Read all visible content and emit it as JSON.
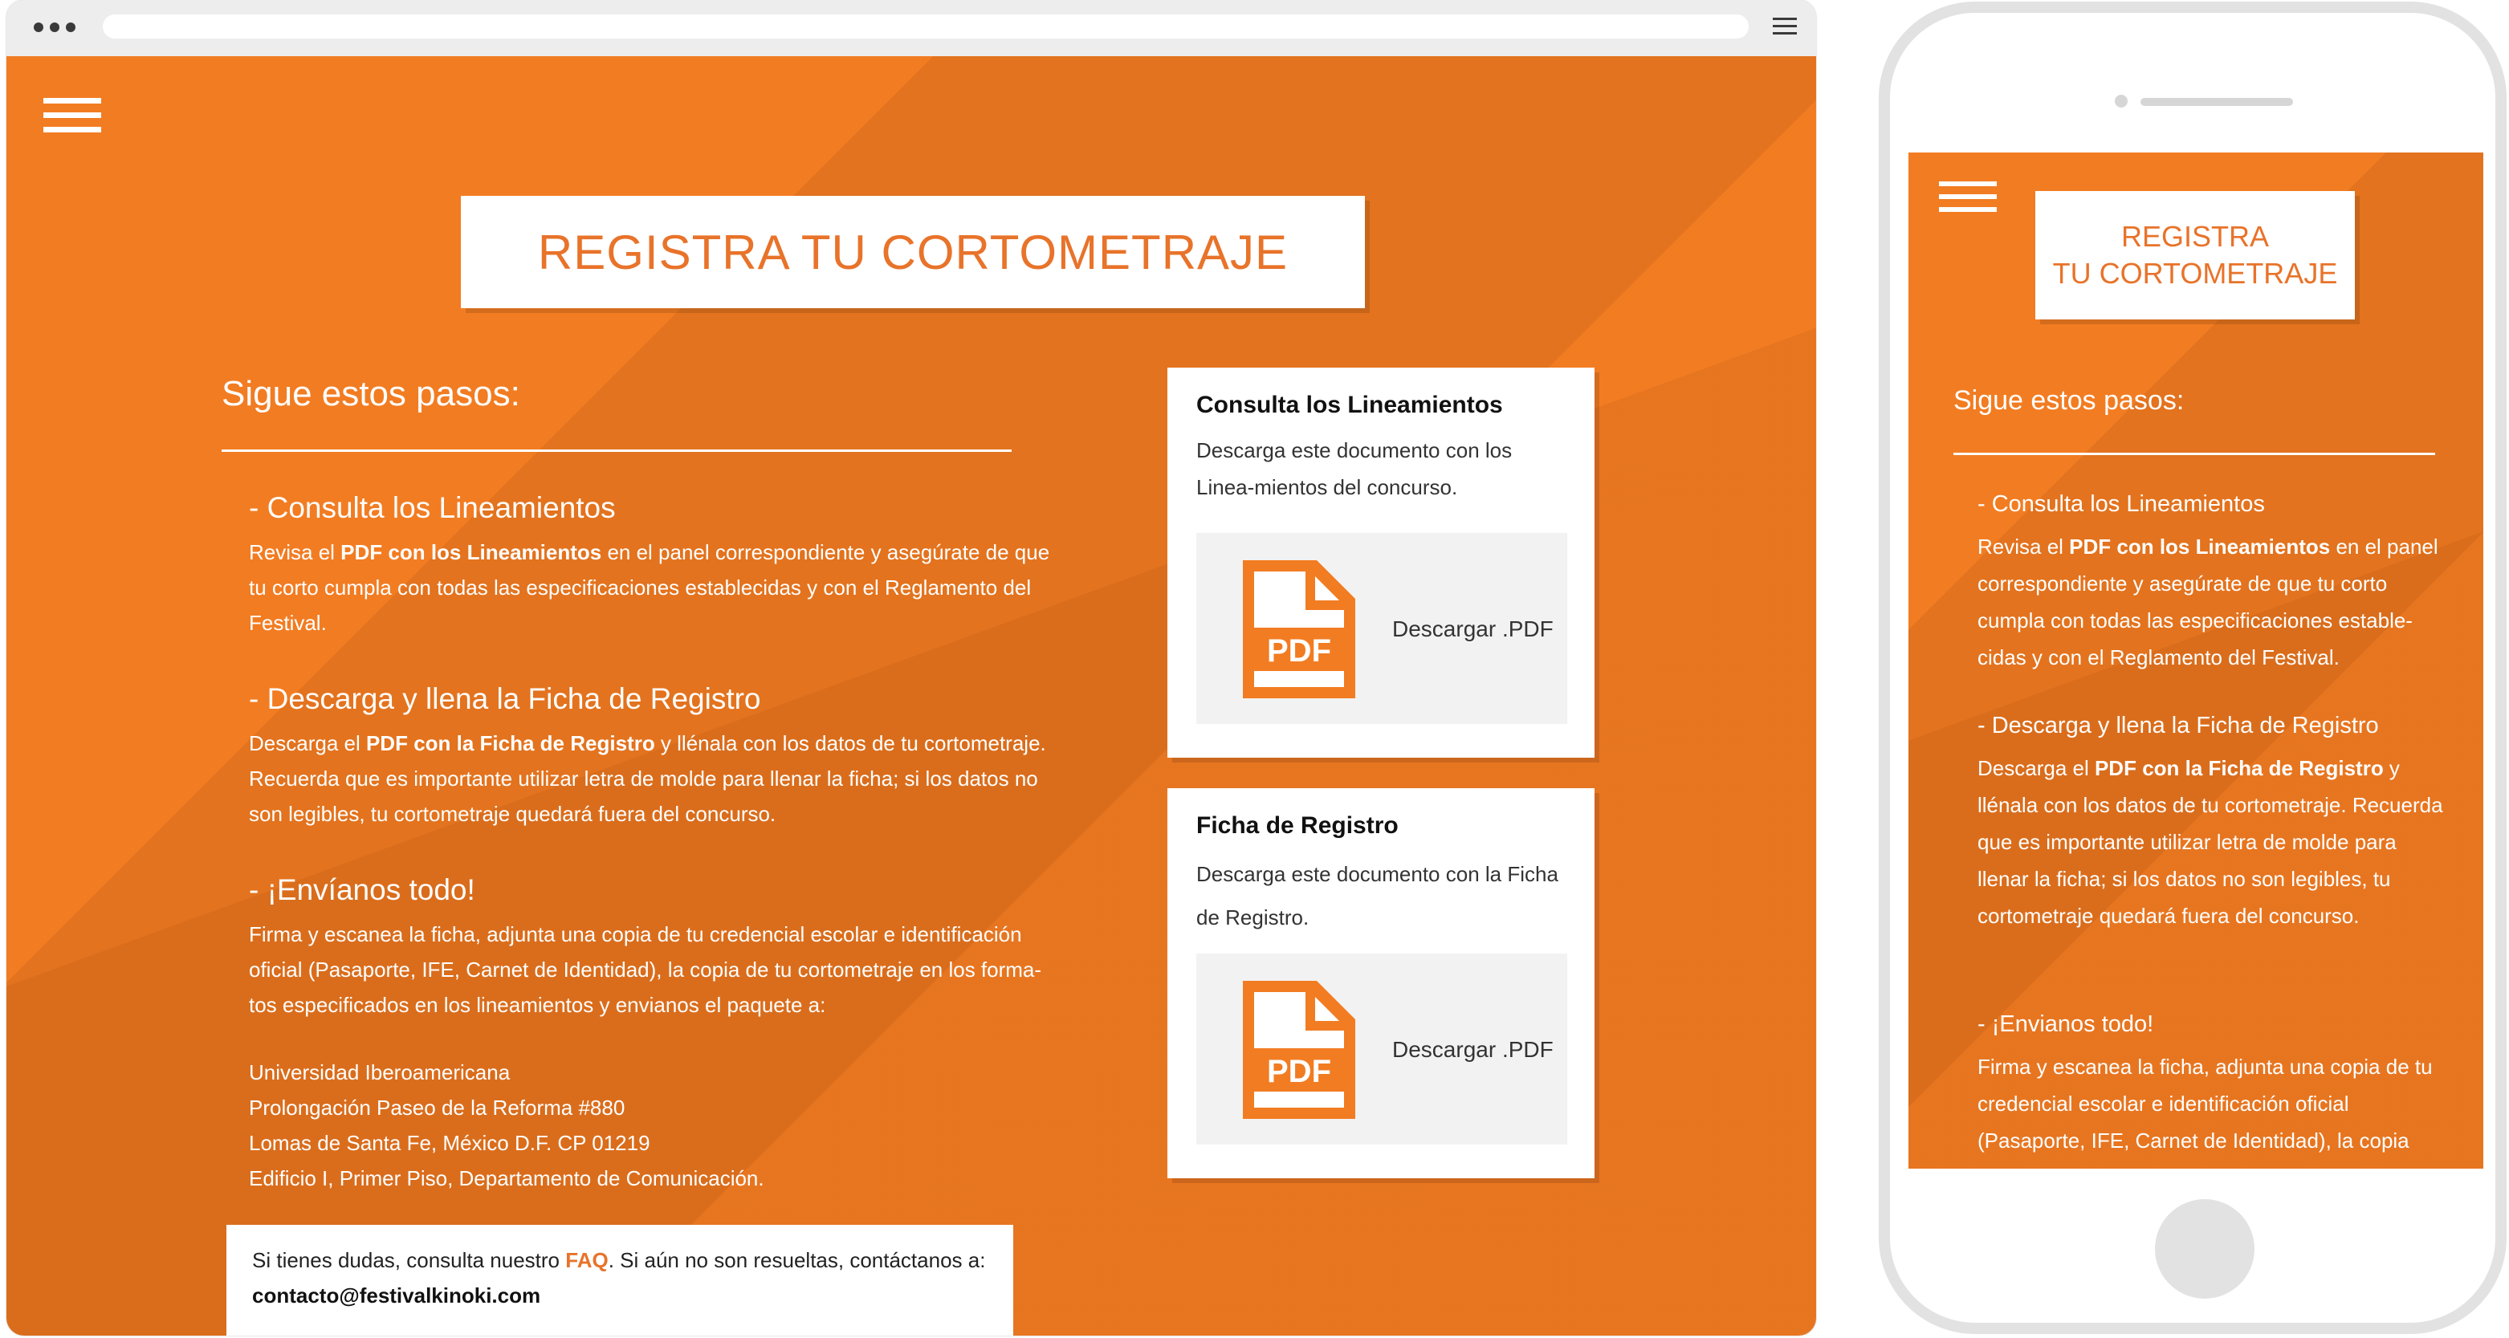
{
  "colors": {
    "accent": "#f27c22",
    "title_text": "#e8732a",
    "white": "#ffffff"
  },
  "desktop": {
    "title": "REGISTRA TU CORTOMETRAJE",
    "steps_title": "Sigue estos pasos:",
    "steps": [
      {
        "heading": "- Consulta los Lineamientos",
        "text_before": "Revisa el ",
        "bold": "PDF con los Lineamientos",
        "text_after": " en el panel correspondiente y asegúrate de que tu corto cumpla con todas las especificaciones establecidas y con el Reglamento del Festival."
      },
      {
        "heading": "- Descarga y llena la Ficha de Registro",
        "text_before": "Descarga el ",
        "bold": "PDF con la Ficha de Registro",
        "text_after": " y llénala con los datos de tu cortometraje. Recuerda que es importante utilizar letra de molde para llenar la ficha; si los datos no son legibles, tu cortometraje quedará fuera del concurso."
      },
      {
        "heading": "- ¡Envíanos todo!",
        "text": "Firma y escanea la ficha, adjunta una copia de tu credencial escolar e identificación oficial (Pasaporte, IFE, Carnet de Identidad), la copia de tu cortometraje en los forma-tos especificados en los lineamientos y envianos el paquete a:"
      }
    ],
    "address": [
      "Universidad Iberoamericana",
      "Prolongación Paseo de la Reforma #880",
      "Lomas de Santa Fe, México D.F. CP 01219",
      "Edificio I, Primer Piso, Departamento de Comunicación."
    ],
    "faq": {
      "before": "Si tienes dudas, consulta nuestro ",
      "link": "FAQ",
      "after": ". Si aún no son resueltas, contáctanos a:",
      "email": "contacto@festivalkinoki.com"
    },
    "cards": [
      {
        "title": "Consulta los Lineamientos",
        "text": "Descarga este documento con los Linea-mientos del concurso.",
        "icon_label": "PDF",
        "download": "Descargar .PDF"
      },
      {
        "title": "Ficha de Registro",
        "text": "Descarga este documento con la Ficha de Registro.",
        "icon_label": "PDF",
        "download": "Descargar .PDF"
      }
    ]
  },
  "mobile": {
    "title_line1": "REGISTRA",
    "title_line2": "TU CORTOMETRAJE",
    "steps_title": "Sigue estos pasos:",
    "steps": [
      {
        "heading": "- Consulta los Lineamientos",
        "text_before": "Revisa el ",
        "bold": "PDF con los Lineamientos",
        "text_after": " en el panel correspondiente y asegúrate de que tu corto cumpla con todas las especificaciones estable-cidas y con el Reglamento del Festival."
      },
      {
        "heading": "- Descarga y llena la Ficha de Registro",
        "text_before": "Descarga el ",
        "bold": "PDF con la Ficha de Registro",
        "text_after": " y llénala con los datos de tu cortometraje. Recuerda que es importante utilizar letra de molde para llenar la ficha; si los datos no son legibles, tu cortometraje quedará fuera del concurso."
      },
      {
        "heading": "- ¡Envianos todo!",
        "text": "Firma y escanea la ficha, adjunta una copia de tu credencial escolar e identificación oficial (Pasaporte, IFE, Carnet de Identidad), la copia"
      }
    ]
  }
}
